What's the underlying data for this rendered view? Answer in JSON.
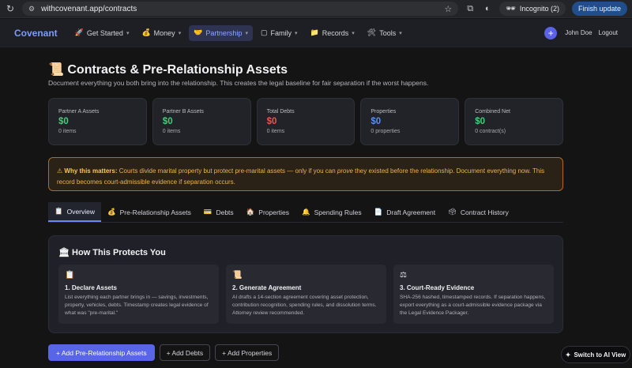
{
  "browser": {
    "url": "withcovenant.app/contracts",
    "incognito_label": "Incognito (2)",
    "update_label": "Finish update"
  },
  "nav": {
    "brand": "Covenant",
    "items": [
      {
        "icon": "🚀",
        "label": "Get Started"
      },
      {
        "icon": "💰",
        "label": "Money"
      },
      {
        "icon": "🤝",
        "label": "Partnership"
      },
      {
        "icon": "▢",
        "label": "Family"
      },
      {
        "icon": "📁",
        "label": "Records"
      },
      {
        "icon": "🛠",
        "label": "Tools"
      }
    ],
    "active": "Partnership",
    "plus": "+",
    "user": "John Doe",
    "logout": "Logout"
  },
  "page": {
    "title_icon": "📜",
    "title": "Contracts & Pre-Relationship Assets",
    "subtitle": "Document everything you both bring into the relationship. This creates the legal baseline for fair separation if the worst happens."
  },
  "stats": [
    {
      "label": "Partner A Assets",
      "value": "$0",
      "sub": "0 items",
      "color": "#39d17a"
    },
    {
      "label": "Partner B Assets",
      "value": "$0",
      "sub": "0 items",
      "color": "#39d17a"
    },
    {
      "label": "Total Debts",
      "value": "$0",
      "sub": "0 items",
      "color": "#f0524f"
    },
    {
      "label": "Properties",
      "value": "$0",
      "sub": "0 properties",
      "color": "#5b8cf5"
    },
    {
      "label": "Combined Net",
      "value": "$0",
      "sub": "0 contract(s)",
      "color": "#39d17a"
    }
  ],
  "warning": {
    "icon": "⚠",
    "lead": "Why this matters:",
    "text_before": " Courts divide marital property but protect pre-marital assets — only if you can ",
    "emphasis": "prove",
    "text_after": " they existed before the relationship. Document everything now. This record becomes court-admissible evidence if separation occurs."
  },
  "tabs": [
    {
      "icon": "📋",
      "label": "Overview"
    },
    {
      "icon": "💰",
      "label": "Pre-Relationship Assets"
    },
    {
      "icon": "💳",
      "label": "Debts"
    },
    {
      "icon": "🏠",
      "label": "Properties"
    },
    {
      "icon": "🔔",
      "label": "Spending Rules"
    },
    {
      "icon": "📄",
      "label": "Draft Agreement"
    },
    {
      "icon": "🗳",
      "label": "Contract History"
    }
  ],
  "active_tab": "Overview",
  "protect": {
    "icon": "🏛",
    "title": "How This Protects You",
    "cards": [
      {
        "icon": "📋",
        "title": "1. Declare Assets",
        "text": "List everything each partner brings in — savings, investments, property, vehicles, debts. Timestamp creates legal evidence of what was \"pre-marital.\""
      },
      {
        "icon": "📜",
        "title": "2. Generate Agreement",
        "text": "AI drafts a 14-section agreement covering asset protection, contribution recognition, spending rules, and dissolution terms. Attorney review recommended."
      },
      {
        "icon": "⚖",
        "title": "3. Court-Ready Evidence",
        "text": "SHA-256 hashed, timestamped records. If separation happens, export everything as a court-admissible evidence package via the Legal Evidence Packager."
      }
    ]
  },
  "actions": {
    "add_assets": "+ Add Pre-Relationship Assets",
    "add_debts": "+ Add Debts",
    "add_properties": "+ Add Properties"
  },
  "ai_toggle": {
    "icon": "✦",
    "label": "Switch to AI View"
  }
}
